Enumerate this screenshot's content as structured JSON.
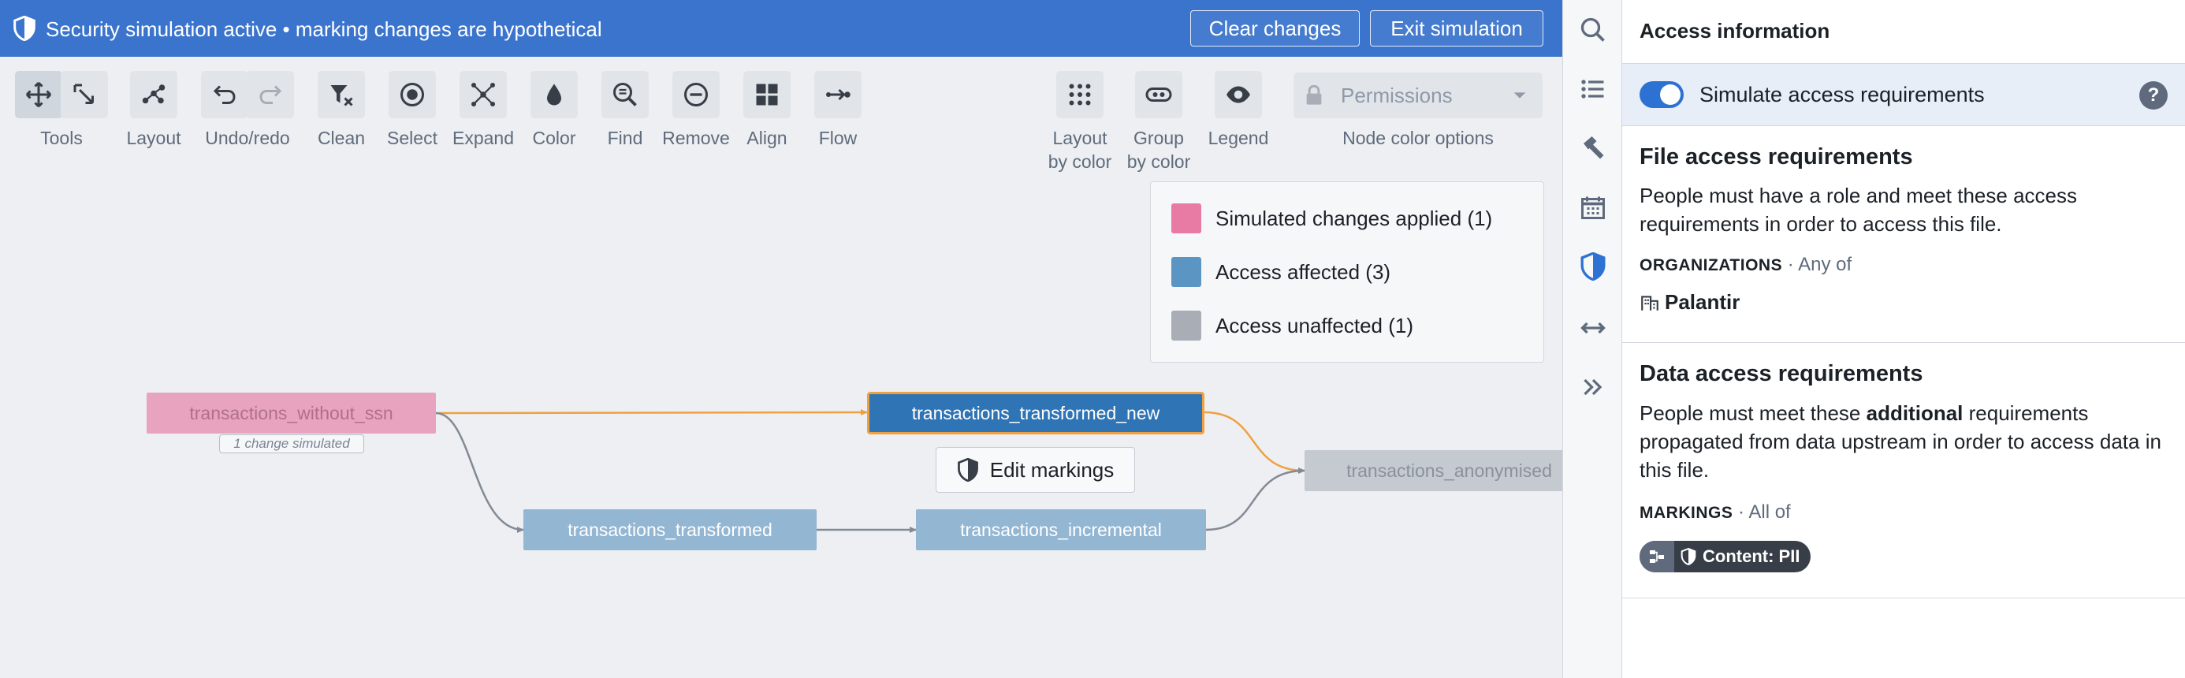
{
  "banner": {
    "title": "Security simulation active • marking changes are hypothetical",
    "clear_label": "Clear changes",
    "exit_label": "Exit simulation"
  },
  "toolbar": {
    "groups": [
      {
        "label": "Tools"
      },
      {
        "label": "Layout"
      },
      {
        "label": "Undo/redo"
      },
      {
        "label": "Clean"
      },
      {
        "label": "Select"
      },
      {
        "label": "Expand"
      },
      {
        "label": "Color"
      },
      {
        "label": "Find"
      },
      {
        "label": "Remove"
      },
      {
        "label": "Align"
      },
      {
        "label": "Flow"
      }
    ],
    "layout_by_color_label": "Layout\nby color",
    "group_by_color_label": "Group\nby color",
    "legend_label": "Legend",
    "permissions_label": "Permissions",
    "node_color_options_label": "Node color options"
  },
  "legend": {
    "items": [
      {
        "label": "Simulated changes applied (1)",
        "color": "#e87ba3"
      },
      {
        "label": "Access affected (3)",
        "color": "#5b95c4"
      },
      {
        "label": "Access unaffected (1)",
        "color": "#a8adb6"
      }
    ]
  },
  "graph": {
    "nodes": {
      "without_ssn": "transactions_without_ssn",
      "transformed_new": "transactions_transformed_new",
      "anonymised": "transactions_anonymised",
      "transformed": "transactions_transformed",
      "incremental": "transactions_incremental"
    },
    "change_tag": "1 change simulated",
    "edit_markings_label": "Edit markings",
    "colors": {
      "simulated": "#e8a4bf",
      "selected": "#2f74b5",
      "affected": "#93b6d3",
      "unaffected": "#c5c9d0",
      "selected_border": "#f0a040",
      "edge_highlight": "#f0a040",
      "edge": "#828a96"
    }
  },
  "panel": {
    "header": "Access information",
    "simulate_label": "Simulate access requirements",
    "help_glyph": "?",
    "file_section": {
      "title": "File access requirements",
      "desc": "People must have a role and meet these access requirements in order to access this file.",
      "key": "ORGANIZATIONS",
      "qualifier": " · Any of",
      "org": "Palantir"
    },
    "data_section": {
      "title": "Data access requirements",
      "desc_pre": "People must meet these ",
      "desc_bold": "additional",
      "desc_post": " requirements propagated from data upstream in order to access data in this file.",
      "key": "MARKINGS",
      "qualifier": " · All of",
      "marking": "Content: PII"
    }
  },
  "rail": {
    "icons": [
      "search-icon",
      "list-icon",
      "hammer-icon",
      "calendar-icon",
      "shield-icon",
      "arrows-horizontal-icon",
      "chevrons-right-icon"
    ]
  }
}
